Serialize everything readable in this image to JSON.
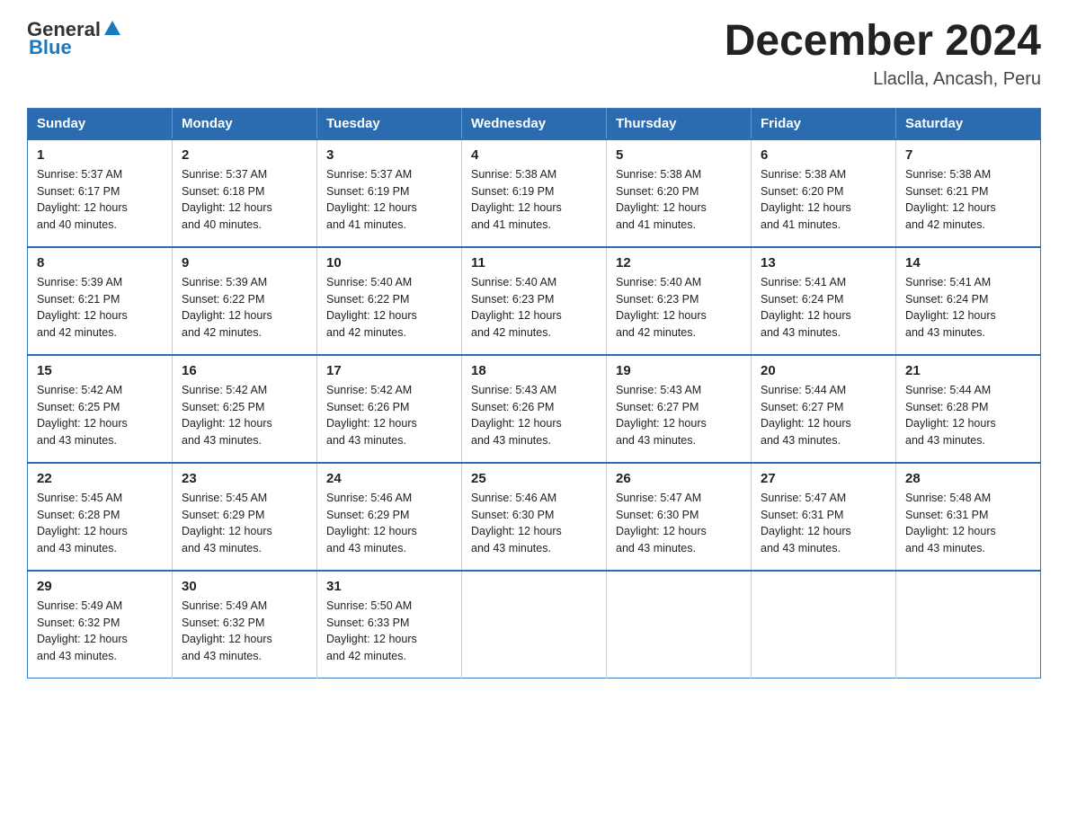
{
  "logo": {
    "text_general": "General",
    "text_blue": "Blue"
  },
  "title": "December 2024",
  "subtitle": "Llaclla, Ancash, Peru",
  "days_of_week": [
    "Sunday",
    "Monday",
    "Tuesday",
    "Wednesday",
    "Thursday",
    "Friday",
    "Saturday"
  ],
  "weeks": [
    [
      {
        "day": "1",
        "info": "Sunrise: 5:37 AM\nSunset: 6:17 PM\nDaylight: 12 hours\nand 40 minutes."
      },
      {
        "day": "2",
        "info": "Sunrise: 5:37 AM\nSunset: 6:18 PM\nDaylight: 12 hours\nand 40 minutes."
      },
      {
        "day": "3",
        "info": "Sunrise: 5:37 AM\nSunset: 6:19 PM\nDaylight: 12 hours\nand 41 minutes."
      },
      {
        "day": "4",
        "info": "Sunrise: 5:38 AM\nSunset: 6:19 PM\nDaylight: 12 hours\nand 41 minutes."
      },
      {
        "day": "5",
        "info": "Sunrise: 5:38 AM\nSunset: 6:20 PM\nDaylight: 12 hours\nand 41 minutes."
      },
      {
        "day": "6",
        "info": "Sunrise: 5:38 AM\nSunset: 6:20 PM\nDaylight: 12 hours\nand 41 minutes."
      },
      {
        "day": "7",
        "info": "Sunrise: 5:38 AM\nSunset: 6:21 PM\nDaylight: 12 hours\nand 42 minutes."
      }
    ],
    [
      {
        "day": "8",
        "info": "Sunrise: 5:39 AM\nSunset: 6:21 PM\nDaylight: 12 hours\nand 42 minutes."
      },
      {
        "day": "9",
        "info": "Sunrise: 5:39 AM\nSunset: 6:22 PM\nDaylight: 12 hours\nand 42 minutes."
      },
      {
        "day": "10",
        "info": "Sunrise: 5:40 AM\nSunset: 6:22 PM\nDaylight: 12 hours\nand 42 minutes."
      },
      {
        "day": "11",
        "info": "Sunrise: 5:40 AM\nSunset: 6:23 PM\nDaylight: 12 hours\nand 42 minutes."
      },
      {
        "day": "12",
        "info": "Sunrise: 5:40 AM\nSunset: 6:23 PM\nDaylight: 12 hours\nand 42 minutes."
      },
      {
        "day": "13",
        "info": "Sunrise: 5:41 AM\nSunset: 6:24 PM\nDaylight: 12 hours\nand 43 minutes."
      },
      {
        "day": "14",
        "info": "Sunrise: 5:41 AM\nSunset: 6:24 PM\nDaylight: 12 hours\nand 43 minutes."
      }
    ],
    [
      {
        "day": "15",
        "info": "Sunrise: 5:42 AM\nSunset: 6:25 PM\nDaylight: 12 hours\nand 43 minutes."
      },
      {
        "day": "16",
        "info": "Sunrise: 5:42 AM\nSunset: 6:25 PM\nDaylight: 12 hours\nand 43 minutes."
      },
      {
        "day": "17",
        "info": "Sunrise: 5:42 AM\nSunset: 6:26 PM\nDaylight: 12 hours\nand 43 minutes."
      },
      {
        "day": "18",
        "info": "Sunrise: 5:43 AM\nSunset: 6:26 PM\nDaylight: 12 hours\nand 43 minutes."
      },
      {
        "day": "19",
        "info": "Sunrise: 5:43 AM\nSunset: 6:27 PM\nDaylight: 12 hours\nand 43 minutes."
      },
      {
        "day": "20",
        "info": "Sunrise: 5:44 AM\nSunset: 6:27 PM\nDaylight: 12 hours\nand 43 minutes."
      },
      {
        "day": "21",
        "info": "Sunrise: 5:44 AM\nSunset: 6:28 PM\nDaylight: 12 hours\nand 43 minutes."
      }
    ],
    [
      {
        "day": "22",
        "info": "Sunrise: 5:45 AM\nSunset: 6:28 PM\nDaylight: 12 hours\nand 43 minutes."
      },
      {
        "day": "23",
        "info": "Sunrise: 5:45 AM\nSunset: 6:29 PM\nDaylight: 12 hours\nand 43 minutes."
      },
      {
        "day": "24",
        "info": "Sunrise: 5:46 AM\nSunset: 6:29 PM\nDaylight: 12 hours\nand 43 minutes."
      },
      {
        "day": "25",
        "info": "Sunrise: 5:46 AM\nSunset: 6:30 PM\nDaylight: 12 hours\nand 43 minutes."
      },
      {
        "day": "26",
        "info": "Sunrise: 5:47 AM\nSunset: 6:30 PM\nDaylight: 12 hours\nand 43 minutes."
      },
      {
        "day": "27",
        "info": "Sunrise: 5:47 AM\nSunset: 6:31 PM\nDaylight: 12 hours\nand 43 minutes."
      },
      {
        "day": "28",
        "info": "Sunrise: 5:48 AM\nSunset: 6:31 PM\nDaylight: 12 hours\nand 43 minutes."
      }
    ],
    [
      {
        "day": "29",
        "info": "Sunrise: 5:49 AM\nSunset: 6:32 PM\nDaylight: 12 hours\nand 43 minutes."
      },
      {
        "day": "30",
        "info": "Sunrise: 5:49 AM\nSunset: 6:32 PM\nDaylight: 12 hours\nand 43 minutes."
      },
      {
        "day": "31",
        "info": "Sunrise: 5:50 AM\nSunset: 6:33 PM\nDaylight: 12 hours\nand 42 minutes."
      },
      {
        "day": "",
        "info": ""
      },
      {
        "day": "",
        "info": ""
      },
      {
        "day": "",
        "info": ""
      },
      {
        "day": "",
        "info": ""
      }
    ]
  ]
}
